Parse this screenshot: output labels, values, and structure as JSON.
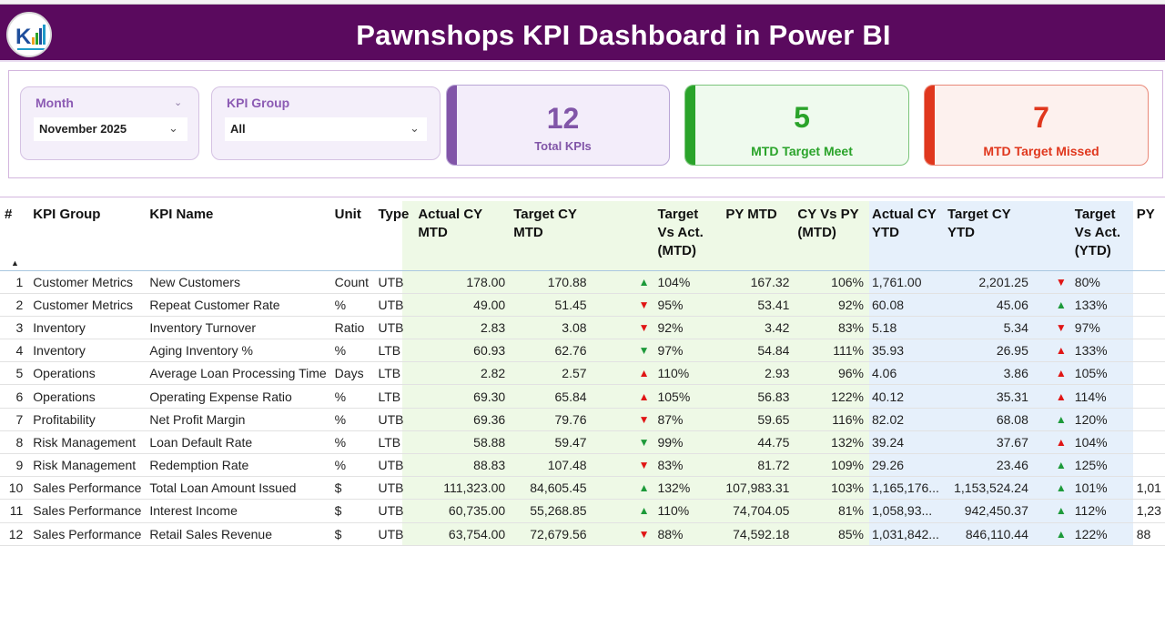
{
  "header": {
    "title": "Pawnshops KPI Dashboard in Power BI",
    "colors": {
      "banner": "#5a0a5e",
      "title_text": "#ffffff"
    },
    "logo_icon": "kpi-logo-icon"
  },
  "filters": {
    "month": {
      "label": "Month",
      "value": "November 2025"
    },
    "kpi_group": {
      "label": "KPI Group",
      "value": "All"
    }
  },
  "cards": {
    "total": {
      "value": "12",
      "label": "Total KPIs",
      "color": "#8155a8"
    },
    "met": {
      "value": "5",
      "label": "MTD Target Meet",
      "color": "#2aa32a"
    },
    "missed": {
      "value": "7",
      "label": "MTD Target Missed",
      "color": "#e0371d"
    }
  },
  "table": {
    "columns": [
      "#",
      "KPI Group",
      "KPI Name",
      "Unit",
      "Type",
      "Actual CY MTD",
      "Target CY MTD",
      "",
      "Target Vs Act. (MTD)",
      "PY MTD",
      "CY Vs PY (MTD)",
      "Actual CY YTD",
      "Target CY YTD",
      "",
      "Target Vs Act. (YTD)",
      "PY"
    ],
    "indicators": {
      "up": "▲",
      "down": "▼"
    },
    "rows": [
      {
        "n": "1",
        "group": "Customer Metrics",
        "name": "New Customers",
        "unit": "Count",
        "type": "UTB",
        "act_mtd": "178.00",
        "tgt_mtd": "170.88",
        "mtd_ind": "up",
        "mtd_pct": "104%",
        "py_mtd": "167.32",
        "cy_py": "106%",
        "act_ytd": "1,761.00",
        "tgt_ytd": "2,201.25",
        "ytd_ind": "down",
        "ytd_pct": "80%",
        "py": ""
      },
      {
        "n": "2",
        "group": "Customer Metrics",
        "name": "Repeat Customer Rate",
        "unit": "%",
        "type": "UTB",
        "act_mtd": "49.00",
        "tgt_mtd": "51.45",
        "mtd_ind": "down",
        "mtd_pct": "95%",
        "py_mtd": "53.41",
        "cy_py": "92%",
        "act_ytd": "60.08",
        "tgt_ytd": "45.06",
        "ytd_ind": "up",
        "ytd_pct": "133%",
        "py": ""
      },
      {
        "n": "3",
        "group": "Inventory",
        "name": "Inventory Turnover",
        "unit": "Ratio",
        "type": "UTB",
        "act_mtd": "2.83",
        "tgt_mtd": "3.08",
        "mtd_ind": "down",
        "mtd_pct": "92%",
        "py_mtd": "3.42",
        "cy_py": "83%",
        "act_ytd": "5.18",
        "tgt_ytd": "5.34",
        "ytd_ind": "down",
        "ytd_pct": "97%",
        "py": ""
      },
      {
        "n": "4",
        "group": "Inventory",
        "name": "Aging Inventory %",
        "unit": "%",
        "type": "LTB",
        "act_mtd": "60.93",
        "tgt_mtd": "62.76",
        "mtd_ind": "down_g",
        "mtd_pct": "97%",
        "py_mtd": "54.84",
        "cy_py": "111%",
        "act_ytd": "35.93",
        "tgt_ytd": "26.95",
        "ytd_ind": "up_r",
        "ytd_pct": "133%",
        "py": ""
      },
      {
        "n": "5",
        "group": "Operations",
        "name": "Average Loan Processing Time",
        "unit": "Days",
        "type": "LTB",
        "act_mtd": "2.82",
        "tgt_mtd": "2.57",
        "mtd_ind": "up_r",
        "mtd_pct": "110%",
        "py_mtd": "2.93",
        "cy_py": "96%",
        "act_ytd": "4.06",
        "tgt_ytd": "3.86",
        "ytd_ind": "up_r",
        "ytd_pct": "105%",
        "py": ""
      },
      {
        "n": "6",
        "group": "Operations",
        "name": "Operating Expense Ratio",
        "unit": "%",
        "type": "LTB",
        "act_mtd": "69.30",
        "tgt_mtd": "65.84",
        "mtd_ind": "up_r",
        "mtd_pct": "105%",
        "py_mtd": "56.83",
        "cy_py": "122%",
        "act_ytd": "40.12",
        "tgt_ytd": "35.31",
        "ytd_ind": "up_r",
        "ytd_pct": "114%",
        "py": ""
      },
      {
        "n": "7",
        "group": "Profitability",
        "name": "Net Profit Margin",
        "unit": "%",
        "type": "UTB",
        "act_mtd": "69.36",
        "tgt_mtd": "79.76",
        "mtd_ind": "down",
        "mtd_pct": "87%",
        "py_mtd": "59.65",
        "cy_py": "116%",
        "act_ytd": "82.02",
        "tgt_ytd": "68.08",
        "ytd_ind": "up",
        "ytd_pct": "120%",
        "py": ""
      },
      {
        "n": "8",
        "group": "Risk Management",
        "name": "Loan Default Rate",
        "unit": "%",
        "type": "LTB",
        "act_mtd": "58.88",
        "tgt_mtd": "59.47",
        "mtd_ind": "down_g",
        "mtd_pct": "99%",
        "py_mtd": "44.75",
        "cy_py": "132%",
        "act_ytd": "39.24",
        "tgt_ytd": "37.67",
        "ytd_ind": "up_r",
        "ytd_pct": "104%",
        "py": ""
      },
      {
        "n": "9",
        "group": "Risk Management",
        "name": "Redemption Rate",
        "unit": "%",
        "type": "UTB",
        "act_mtd": "88.83",
        "tgt_mtd": "107.48",
        "mtd_ind": "down",
        "mtd_pct": "83%",
        "py_mtd": "81.72",
        "cy_py": "109%",
        "act_ytd": "29.26",
        "tgt_ytd": "23.46",
        "ytd_ind": "up",
        "ytd_pct": "125%",
        "py": ""
      },
      {
        "n": "10",
        "group": "Sales Performance",
        "name": "Total Loan Amount Issued",
        "unit": "$",
        "type": "UTB",
        "act_mtd": "111,323.00",
        "tgt_mtd": "84,605.45",
        "mtd_ind": "up",
        "mtd_pct": "132%",
        "py_mtd": "107,983.31",
        "cy_py": "103%",
        "act_ytd": "1,165,176...",
        "tgt_ytd": "1,153,524.24",
        "ytd_ind": "up",
        "ytd_pct": "101%",
        "py": "1,01"
      },
      {
        "n": "11",
        "group": "Sales Performance",
        "name": "Interest Income",
        "unit": "$",
        "type": "UTB",
        "act_mtd": "60,735.00",
        "tgt_mtd": "55,268.85",
        "mtd_ind": "up",
        "mtd_pct": "110%",
        "py_mtd": "74,704.05",
        "cy_py": "81%",
        "act_ytd": "1,058,93...",
        "tgt_ytd": "942,450.37",
        "ytd_ind": "up",
        "ytd_pct": "112%",
        "py": "1,23"
      },
      {
        "n": "12",
        "group": "Sales Performance",
        "name": "Retail Sales Revenue",
        "unit": "$",
        "type": "UTB",
        "act_mtd": "63,754.00",
        "tgt_mtd": "72,679.56",
        "mtd_ind": "down",
        "mtd_pct": "88%",
        "py_mtd": "74,592.18",
        "cy_py": "85%",
        "act_ytd": "1,031,842...",
        "tgt_ytd": "846,110.44",
        "ytd_ind": "up",
        "ytd_pct": "122%",
        "py": "88"
      }
    ],
    "colors": {
      "mtd_band": "#eef9e6",
      "ytd_band": "#e6f0fb",
      "up": "#1d9a3a",
      "down": "#e01515"
    }
  }
}
